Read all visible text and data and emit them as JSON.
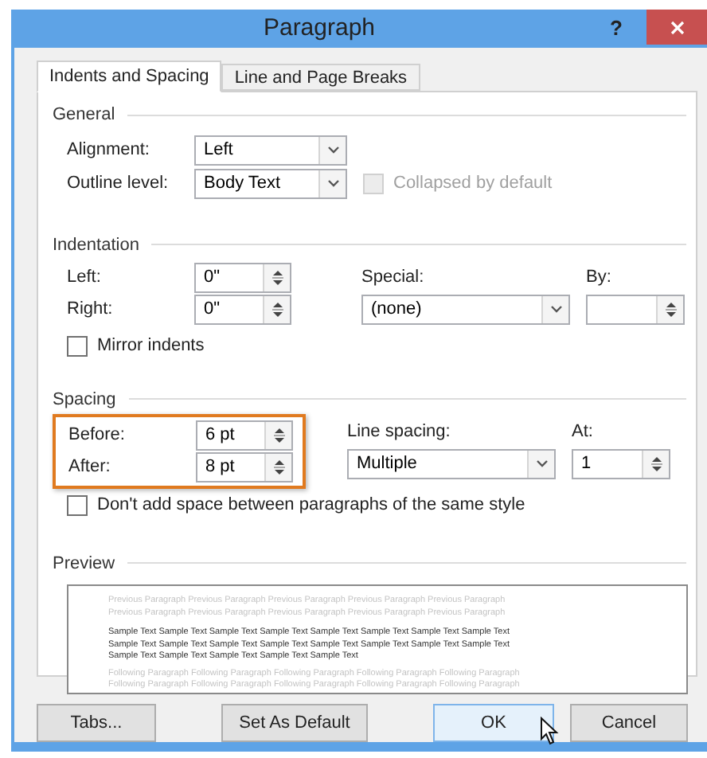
{
  "window": {
    "title": "Paragraph",
    "help": "?"
  },
  "tabs": [
    {
      "label": "Indents and Spacing",
      "selected": true
    },
    {
      "label": "Line and Page Breaks",
      "selected": false
    }
  ],
  "general": {
    "heading": "General",
    "alignment": {
      "label": "Alignment:",
      "value": "Left"
    },
    "outline_level": {
      "label": "Outline level:",
      "value": "Body Text"
    },
    "collapsed": {
      "label": "Collapsed by default",
      "checked": false,
      "disabled": true
    }
  },
  "indentation": {
    "heading": "Indentation",
    "left": {
      "label": "Left:",
      "value": "0\""
    },
    "right": {
      "label": "Right:",
      "value": "0\""
    },
    "special": {
      "label": "Special:",
      "value": "(none)"
    },
    "by": {
      "label": "By:"
    },
    "mirror": {
      "label": "Mirror indents",
      "checked": false,
      "disabled": false
    }
  },
  "spacing": {
    "heading": "Spacing",
    "highlighted": true,
    "before": {
      "label": "Before:",
      "value": "6 pt"
    },
    "after": {
      "label": "After:",
      "value": "8 pt"
    },
    "line_spacing": {
      "label": "Line spacing:",
      "value": "Multiple"
    },
    "at": {
      "label": "At:",
      "value": "1"
    },
    "dont_add": {
      "label": "Don't add space between paragraphs of the same style",
      "checked": false,
      "disabled": false
    }
  },
  "preview": {
    "heading": "Preview",
    "previous": [
      "Previous Paragraph Previous Paragraph Previous Paragraph Previous Paragraph Previous Paragraph",
      "Previous Paragraph Previous Paragraph Previous Paragraph Previous Paragraph Previous Paragraph"
    ],
    "sample": [
      "Sample Text Sample Text Sample Text Sample Text Sample Text Sample Text Sample Text Sample Text",
      "Sample Text Sample Text Sample Text Sample Text Sample Text Sample Text Sample Text Sample Text",
      "Sample Text Sample Text Sample Text Sample Text Sample Text"
    ],
    "following": [
      "Following Paragraph Following Paragraph Following Paragraph Following Paragraph Following Paragraph",
      "Following Paragraph Following Paragraph Following Paragraph Following Paragraph Following Paragraph"
    ]
  },
  "buttons": [
    {
      "label": "Tabs...",
      "hovered": false
    },
    {
      "label": "Set As Default",
      "hovered": false
    },
    {
      "label": "OK",
      "hovered": true
    },
    {
      "label": "Cancel",
      "hovered": false
    }
  ]
}
